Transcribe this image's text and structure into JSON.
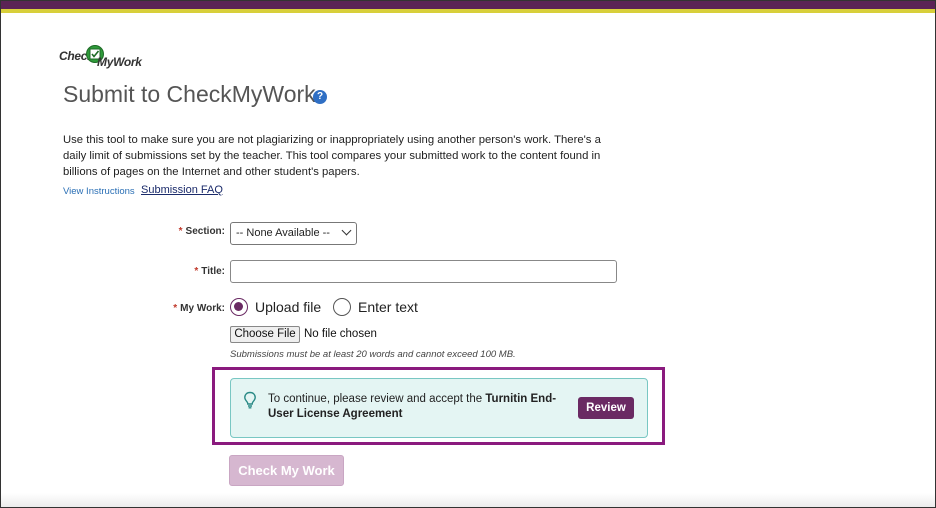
{
  "header": {
    "logo_text_1": "Check",
    "logo_text_2": "MyWork",
    "accent_purple": "#5b2355",
    "accent_gold": "#d8cf3a"
  },
  "page": {
    "title": "Submit to CheckMyWork",
    "help_icon": "question-circle-icon",
    "help_glyph": "?",
    "description": "Use this tool to make sure you are not plagiarizing or inappropriately using another person's work. There's a daily limit of submissions set by the teacher. This tool compares your submitted work to the content found in billions of pages on the Internet and other student's papers.",
    "link_instructions": "View Instructions",
    "link_faq": "Submission FAQ"
  },
  "form": {
    "required_marker": "*",
    "section_label": "Section:",
    "section_value": "-- None Available --",
    "title_label": "Title:",
    "title_value": "",
    "mywork_label": "My Work:",
    "radio_upload": "Upload file",
    "radio_text": "Enter text",
    "selected_option": "Upload file",
    "choose_file_button": "Choose File",
    "file_status": "No file chosen",
    "file_hint": "Submissions must be at least 20 words and cannot exceed 100 MB."
  },
  "notice": {
    "icon": "lightbulb-icon",
    "text_before": "To continue, please review and accept the ",
    "text_bold": "Turnitin End-User License Agreement",
    "review_button": "Review",
    "highlight_color": "#8a1a7e"
  },
  "actions": {
    "submit_button": "Check My Work",
    "submit_disabled": true
  }
}
